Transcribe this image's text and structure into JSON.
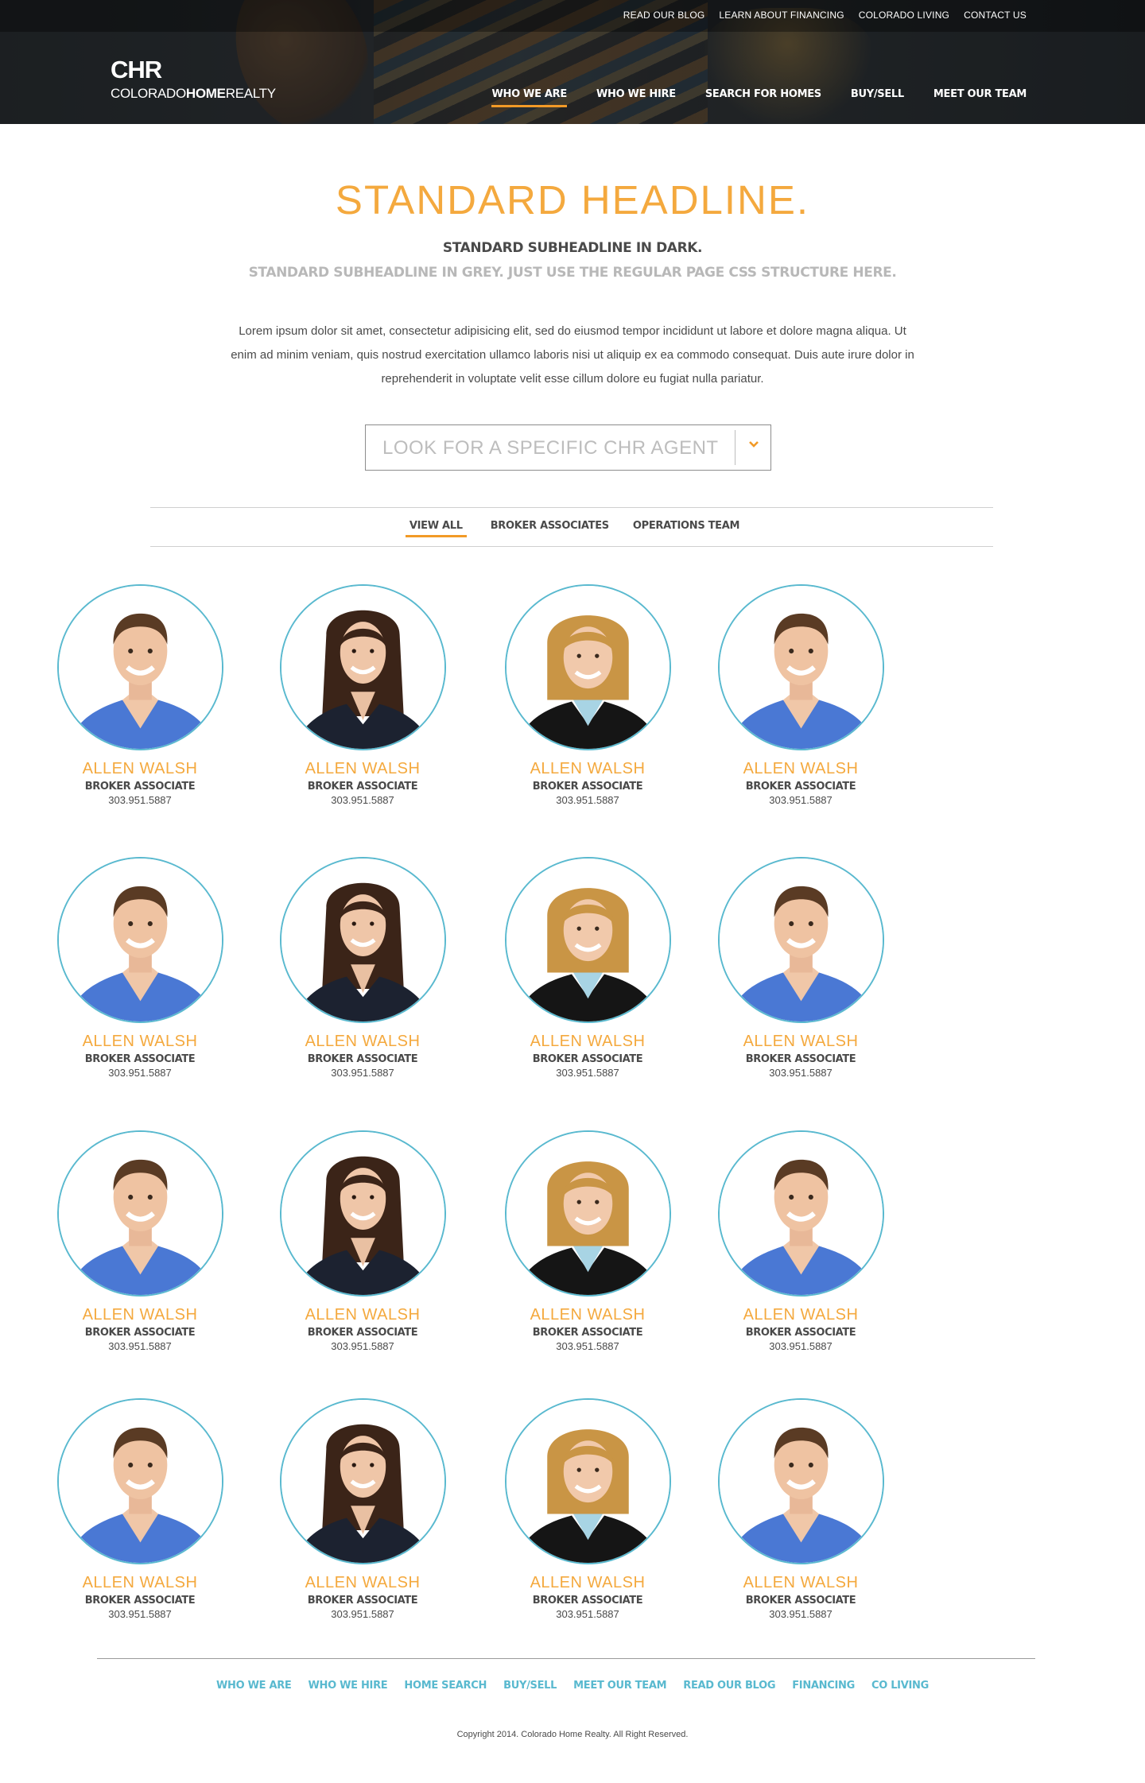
{
  "header": {
    "utility_nav": [
      "READ OUR BLOG",
      "LEARN ABOUT FINANCING",
      "COLORADO LIVING",
      "CONTACT US"
    ],
    "logo": {
      "mark": "CHR",
      "word_light_1": "COLORADO",
      "word_bold": "HOME",
      "word_light_2": "REALTY"
    },
    "main_nav": [
      "WHO WE ARE",
      "WHO WE HIRE",
      "SEARCH FOR HOMES",
      "BUY/SELL",
      "MEET OUR TEAM"
    ],
    "active_nav": "WHO WE ARE"
  },
  "intro": {
    "headline": "STANDARD HEADLINE.",
    "subheadline_dark": "STANDARD SUBHEADLINE IN DARK.",
    "subheadline_grey": "STANDARD SUBHEADLINE IN GREY. JUST USE THE REGULAR PAGE CSS STRUCTURE HERE.",
    "body": "Lorem ipsum dolor sit amet, consectetur adipisicing elit, sed do eiusmod tempor incididunt ut labore et dolore magna aliqua. Ut enim ad minim veniam, quis nostrud exercitation ullamco laboris nisi ut aliquip ex ea commodo consequat. Duis aute irure dolor in reprehenderit in voluptate velit esse cillum dolore eu fugiat nulla pariatur."
  },
  "agent_search": {
    "placeholder": "LOOK FOR A SPECIFIC CHR AGENT",
    "icon": "chevron-down-icon"
  },
  "filter_tabs": [
    "VIEW ALL",
    "BROKER ASSOCIATES",
    "OPERATIONS TEAM"
  ],
  "active_tab": "VIEW ALL",
  "agents": [
    {
      "name": "ALLEN WALSH",
      "role": "BROKER ASSOCIATE",
      "phone": "303.951.5887",
      "photo": "man-blue-shirt"
    },
    {
      "name": "ALLEN WALSH",
      "role": "BROKER ASSOCIATE",
      "phone": "303.951.5887",
      "photo": "woman-dark-hair"
    },
    {
      "name": "ALLEN WALSH",
      "role": "BROKER ASSOCIATE",
      "phone": "303.951.5887",
      "photo": "woman-blonde-hair"
    },
    {
      "name": "ALLEN WALSH",
      "role": "BROKER ASSOCIATE",
      "phone": "303.951.5887",
      "photo": "man-blue-shirt"
    },
    {
      "name": "ALLEN WALSH",
      "role": "BROKER ASSOCIATE",
      "phone": "303.951.5887",
      "photo": "man-blue-shirt"
    },
    {
      "name": "ALLEN WALSH",
      "role": "BROKER ASSOCIATE",
      "phone": "303.951.5887",
      "photo": "woman-dark-hair"
    },
    {
      "name": "ALLEN WALSH",
      "role": "BROKER ASSOCIATE",
      "phone": "303.951.5887",
      "photo": "woman-blonde-hair"
    },
    {
      "name": "ALLEN WALSH",
      "role": "BROKER ASSOCIATE",
      "phone": "303.951.5887",
      "photo": "man-blue-shirt"
    },
    {
      "name": "ALLEN WALSH",
      "role": "BROKER ASSOCIATE",
      "phone": "303.951.5887",
      "photo": "man-blue-shirt"
    },
    {
      "name": "ALLEN WALSH",
      "role": "BROKER ASSOCIATE",
      "phone": "303.951.5887",
      "photo": "woman-dark-hair"
    },
    {
      "name": "ALLEN WALSH",
      "role": "BROKER ASSOCIATE",
      "phone": "303.951.5887",
      "photo": "woman-blonde-hair"
    },
    {
      "name": "ALLEN WALSH",
      "role": "BROKER ASSOCIATE",
      "phone": "303.951.5887",
      "photo": "man-blue-shirt"
    },
    {
      "name": "ALLEN WALSH",
      "role": "BROKER ASSOCIATE",
      "phone": "303.951.5887",
      "photo": "man-blue-shirt"
    },
    {
      "name": "ALLEN WALSH",
      "role": "BROKER ASSOCIATE",
      "phone": "303.951.5887",
      "photo": "woman-dark-hair"
    },
    {
      "name": "ALLEN WALSH",
      "role": "BROKER ASSOCIATE",
      "phone": "303.951.5887",
      "photo": "woman-blonde-hair"
    },
    {
      "name": "ALLEN WALSH",
      "role": "BROKER ASSOCIATE",
      "phone": "303.951.5887",
      "photo": "man-blue-shirt"
    }
  ],
  "footer": {
    "nav": [
      "WHO WE ARE",
      "WHO WE HIRE",
      "HOME SEARCH",
      "BUY/SELL",
      "MEET OUR TEAM",
      "READ OUR BLOG",
      "FINANCING",
      "CO LIVING"
    ],
    "copyright": "Copyright 2014. Colorado Home Realty. All Right Reserved."
  },
  "colors": {
    "accent_orange": "#f29a27",
    "headline_orange": "#f4a93e",
    "avatar_ring": "#59b9cf",
    "footer_link": "#59b9cf"
  }
}
